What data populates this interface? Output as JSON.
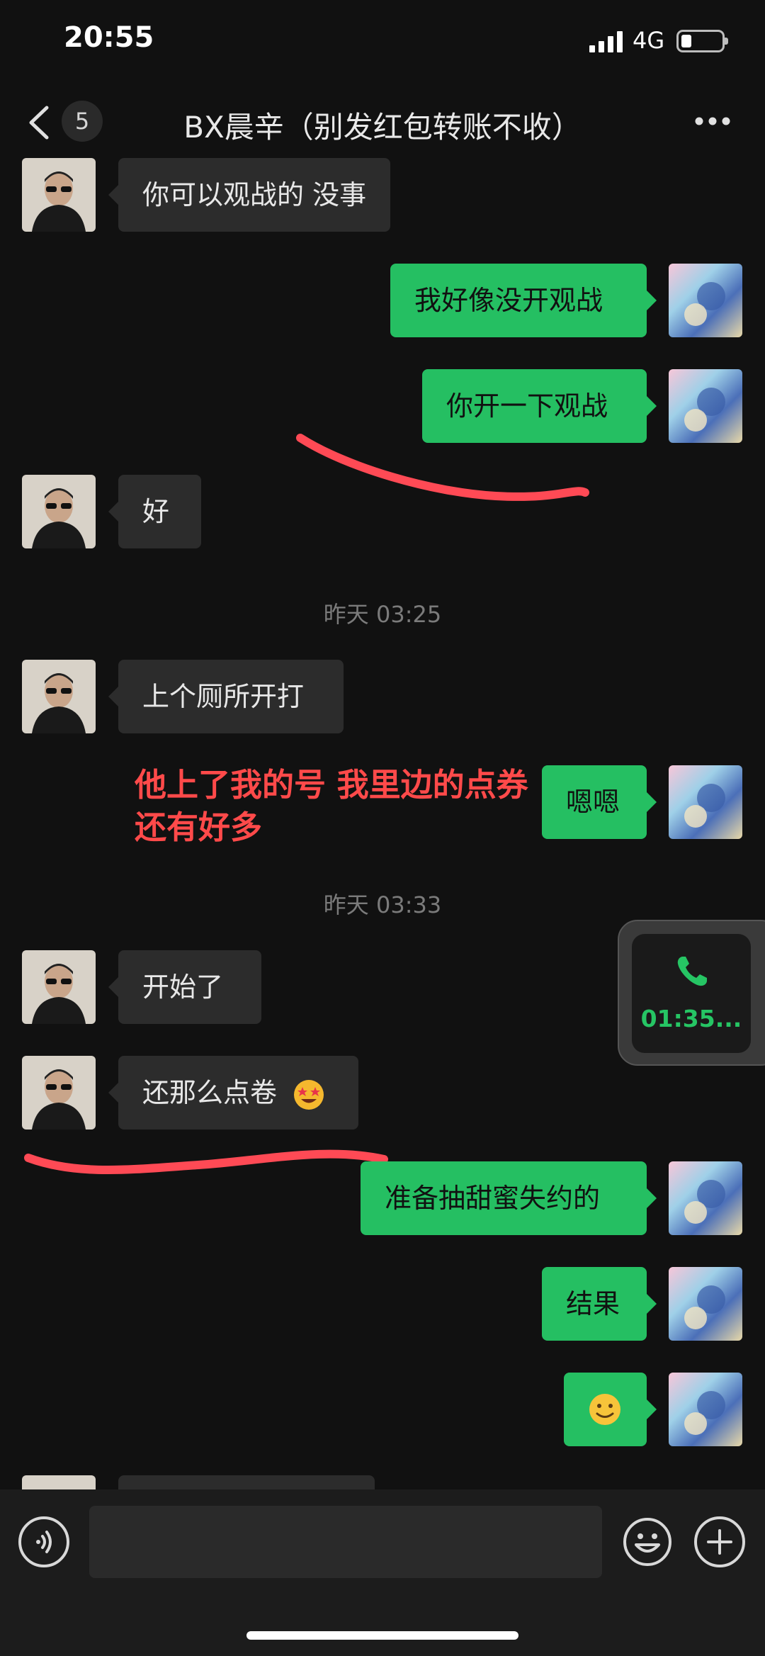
{
  "status_bar": {
    "time": "20:55",
    "network": "4G"
  },
  "nav": {
    "unread_count": "5",
    "title": "BX晨辛（别发红包转账不收）"
  },
  "messages": [
    {
      "side": "in",
      "text": "你可以观战的 没事"
    },
    {
      "side": "out",
      "text": "我好像没开观战"
    },
    {
      "side": "out",
      "text": "你开一下观战"
    },
    {
      "side": "in",
      "text": "好"
    },
    {
      "side": "in",
      "text": "上个厕所开打"
    },
    {
      "side": "out",
      "text": "嗯嗯"
    },
    {
      "side": "in",
      "text": "开始了"
    },
    {
      "side": "in",
      "text": "还那么点卷",
      "emoji": "star-struck-emoji"
    },
    {
      "side": "out",
      "text": "准备抽甜蜜失约的"
    },
    {
      "side": "out",
      "text": "结果"
    },
    {
      "side": "out",
      "text": "",
      "emoji": "smile-emoji"
    }
  ],
  "timestamps": [
    "昨天 03:25",
    "昨天 03:33"
  ],
  "annotation": "他上了我的号 我里边的点券还有好多",
  "call_float": {
    "duration": "01:35..."
  },
  "input": {
    "value": ""
  },
  "colors": {
    "bubble_out": "#25bf62",
    "bubble_in": "#2c2c2c",
    "annotation": "#ff4a4a",
    "scribble": "#ff4a55"
  }
}
